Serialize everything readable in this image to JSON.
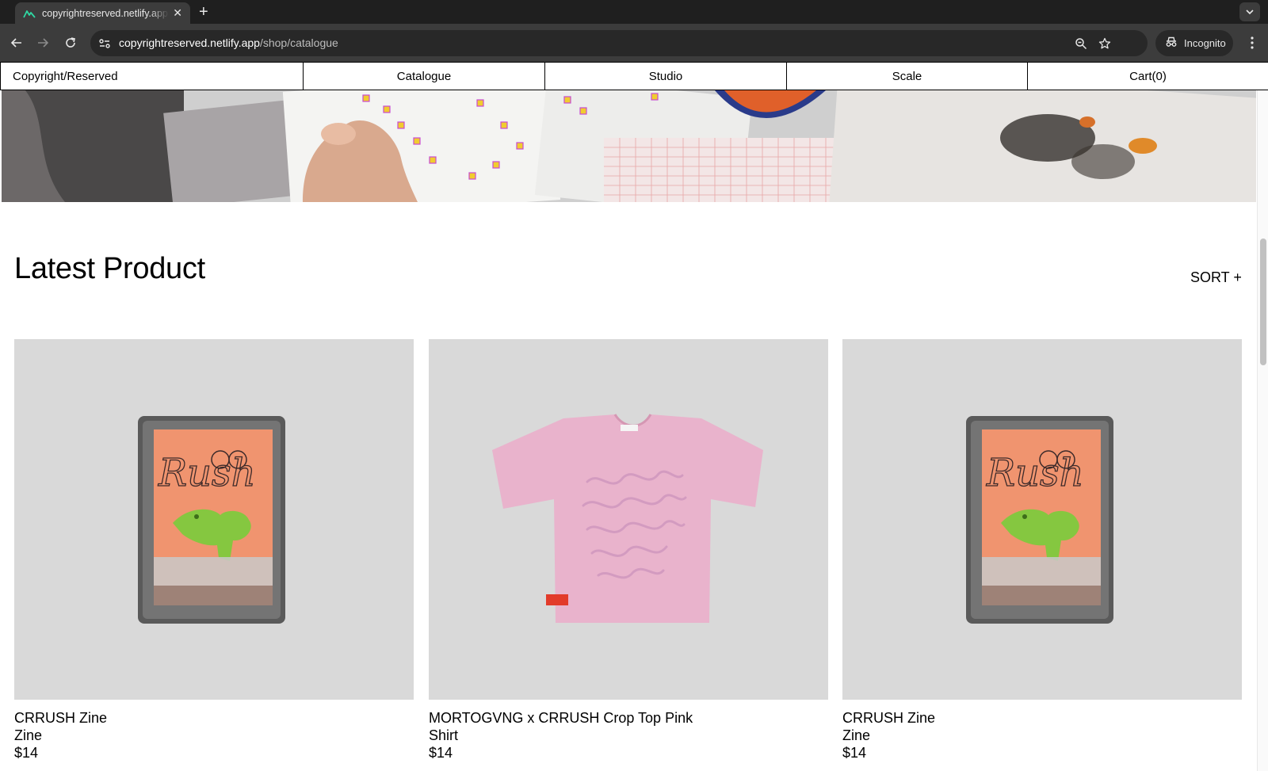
{
  "browser": {
    "tab": {
      "title": "copyrightreserved.netlify.app"
    },
    "url": {
      "host": "copyrightreserved.netlify.app",
      "path": "/shop/catalogue"
    },
    "incognito_label": "Incognito"
  },
  "site_nav": {
    "items": [
      {
        "label": "Copyright/Reserved"
      },
      {
        "label": "Catalogue"
      },
      {
        "label": "Studio"
      },
      {
        "label": "Scale"
      },
      {
        "label": "Cart(0)"
      }
    ]
  },
  "main": {
    "section_title": "Latest Product",
    "sort_label": "SORT +",
    "products": [
      {
        "name": "CRRUSH Zine",
        "type": "Zine",
        "price": "$14",
        "image": "crrush-zine-package"
      },
      {
        "name": "MORTOGVNG x CRRUSH Crop Top Pink",
        "type": "Shirt",
        "price": "$14",
        "image": "pink-t-shirt"
      },
      {
        "name": "CRRUSH Zine",
        "type": "Zine",
        "price": "$14",
        "image": "crrush-zine-package"
      }
    ]
  },
  "colors": {
    "chrome_dark": "#1f1f1f",
    "chrome_toolbar": "#3c3c3c",
    "product_bg": "#d9d9d9",
    "zine_orange": "#f0946f",
    "shirt_pink": "#e9b3cc"
  }
}
